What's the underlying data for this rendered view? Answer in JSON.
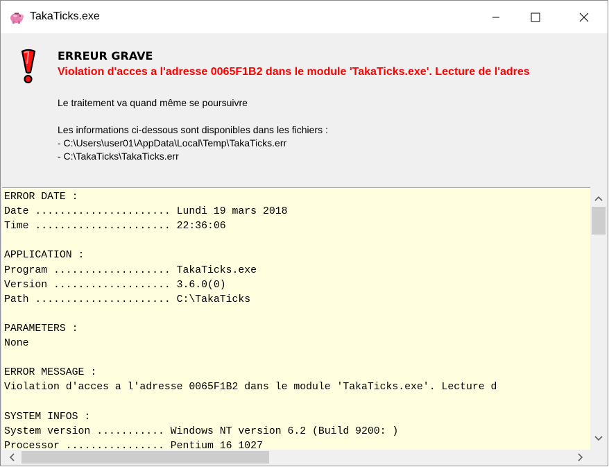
{
  "window": {
    "title": "TakaTicks.exe",
    "app_icon": "piggy-bank-icon"
  },
  "titlebar_buttons": [
    {
      "name": "minimize",
      "icon": "minimize-icon"
    },
    {
      "name": "maximize",
      "icon": "maximize-icon"
    },
    {
      "name": "close",
      "icon": "close-icon"
    }
  ],
  "header": {
    "icon": "exclamation-icon",
    "title": "ERREUR GRAVE",
    "message": "Violation d'acces a l'adresse 0065F1B2 dans le module 'TakaTicks.exe'. Lecture de l'adres",
    "continue_text": "Le traitement va quand même se poursuivre",
    "files_intro": "Les informations ci-dessous sont disponibles dans les fichiers :",
    "file1": "- C:\\Users\\user01\\AppData\\Local\\Temp\\TakaTicks.err",
    "file2": "- C:\\TakaTicks\\TakaTicks.err"
  },
  "log_lines": [
    "ERROR DATE :",
    "Date ...................... Lundi 19 mars 2018",
    "Time ...................... 22:36:06",
    "",
    "APPLICATION :",
    "Program ................... TakaTicks.exe",
    "Version ................... 3.6.0(0)",
    "Path ...................... C:\\TakaTicks",
    "",
    "PARAMETERS :",
    "None",
    "",
    "ERROR MESSAGE :",
    "Violation d'acces a l'adresse 0065F1B2 dans le module 'TakaTicks.exe'. Lecture d",
    "",
    "SYSTEM INFOS :",
    "System version ........... Windows NT version 6.2 (Build 9200: )",
    "Processor ................ Pentium 16 1027"
  ],
  "colors": {
    "error_red": "#ff0000",
    "log_background": "#ffffe0",
    "dialog_background": "#f0f0f0"
  }
}
